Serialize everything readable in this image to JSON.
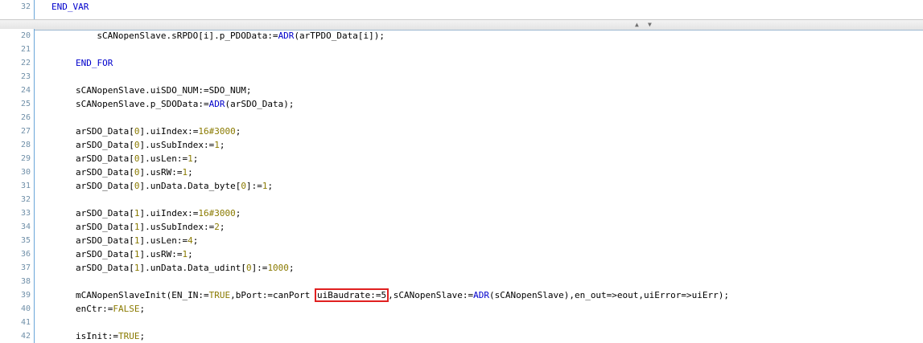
{
  "top_pane": {
    "line_number": "32",
    "text": "END_VAR"
  },
  "splitter": {
    "up_arrow": "▲",
    "down_arrow": "▼"
  },
  "lines": [
    {
      "n": "20",
      "indent": 8,
      "tokens": [
        [
          "sCANopenSlave.sRPDO[i].p_PDOData:=",
          ""
        ],
        [
          "ADR",
          "kw"
        ],
        [
          "(arTPDO_Data[i]);",
          ""
        ]
      ]
    },
    {
      "n": "21",
      "indent": 0,
      "tokens": []
    },
    {
      "n": "22",
      "indent": 4,
      "tokens": [
        [
          "END_FOR",
          "kw"
        ]
      ]
    },
    {
      "n": "23",
      "indent": 0,
      "tokens": []
    },
    {
      "n": "24",
      "indent": 4,
      "tokens": [
        [
          "sCANopenSlave.uiSDO_NUM:=SDO_NUM;",
          ""
        ]
      ]
    },
    {
      "n": "25",
      "indent": 4,
      "tokens": [
        [
          "sCANopenSlave.p_SDOData:=",
          ""
        ],
        [
          "ADR",
          "kw"
        ],
        [
          "(arSDO_Data);",
          ""
        ]
      ]
    },
    {
      "n": "26",
      "indent": 0,
      "tokens": []
    },
    {
      "n": "27",
      "indent": 4,
      "tokens": [
        [
          "arSDO_Data[",
          ""
        ],
        [
          "0",
          "num"
        ],
        [
          "].uiIndex:=",
          ""
        ],
        [
          "16#3000",
          "num"
        ],
        [
          ";",
          ""
        ]
      ]
    },
    {
      "n": "28",
      "indent": 4,
      "tokens": [
        [
          "arSDO_Data[",
          ""
        ],
        [
          "0",
          "num"
        ],
        [
          "].usSubIndex:=",
          ""
        ],
        [
          "1",
          "num"
        ],
        [
          ";",
          ""
        ]
      ]
    },
    {
      "n": "29",
      "indent": 4,
      "tokens": [
        [
          "arSDO_Data[",
          ""
        ],
        [
          "0",
          "num"
        ],
        [
          "].usLen:=",
          ""
        ],
        [
          "1",
          "num"
        ],
        [
          ";",
          ""
        ]
      ]
    },
    {
      "n": "30",
      "indent": 4,
      "tokens": [
        [
          "arSDO_Data[",
          ""
        ],
        [
          "0",
          "num"
        ],
        [
          "].usRW:=",
          ""
        ],
        [
          "1",
          "num"
        ],
        [
          ";",
          ""
        ]
      ]
    },
    {
      "n": "31",
      "indent": 4,
      "tokens": [
        [
          "arSDO_Data[",
          ""
        ],
        [
          "0",
          "num"
        ],
        [
          "].unData.Data_byte[",
          ""
        ],
        [
          "0",
          "num"
        ],
        [
          "]:=",
          ""
        ],
        [
          "1",
          "num"
        ],
        [
          ";",
          ""
        ]
      ]
    },
    {
      "n": "32",
      "indent": 0,
      "tokens": []
    },
    {
      "n": "33",
      "indent": 4,
      "tokens": [
        [
          "arSDO_Data[",
          ""
        ],
        [
          "1",
          "num"
        ],
        [
          "].uiIndex:=",
          ""
        ],
        [
          "16#3000",
          "num"
        ],
        [
          ";",
          ""
        ]
      ]
    },
    {
      "n": "34",
      "indent": 4,
      "tokens": [
        [
          "arSDO_Data[",
          ""
        ],
        [
          "1",
          "num"
        ],
        [
          "].usSubIndex:=",
          ""
        ],
        [
          "2",
          "num"
        ],
        [
          ";",
          ""
        ]
      ]
    },
    {
      "n": "35",
      "indent": 4,
      "tokens": [
        [
          "arSDO_Data[",
          ""
        ],
        [
          "1",
          "num"
        ],
        [
          "].usLen:=",
          ""
        ],
        [
          "4",
          "num"
        ],
        [
          ";",
          ""
        ]
      ]
    },
    {
      "n": "36",
      "indent": 4,
      "tokens": [
        [
          "arSDO_Data[",
          ""
        ],
        [
          "1",
          "num"
        ],
        [
          "].usRW:=",
          ""
        ],
        [
          "1",
          "num"
        ],
        [
          ";",
          ""
        ]
      ]
    },
    {
      "n": "37",
      "indent": 4,
      "tokens": [
        [
          "arSDO_Data[",
          ""
        ],
        [
          "1",
          "num"
        ],
        [
          "].unData.Data_udint[",
          ""
        ],
        [
          "0",
          "num"
        ],
        [
          "]:=",
          ""
        ],
        [
          "1000",
          "num"
        ],
        [
          ";",
          ""
        ]
      ]
    },
    {
      "n": "38",
      "indent": 0,
      "tokens": []
    },
    {
      "n": "39",
      "indent": 4,
      "tokens": [
        [
          "mCANopenSlaveInit(EN_IN:=",
          ""
        ],
        [
          "TRUE",
          "num"
        ],
        [
          ",bPort:=canPort ",
          ""
        ],
        [
          "uiBaudrate:=5",
          "box"
        ],
        [
          ",sCANopenSlave:=",
          ""
        ],
        [
          "ADR",
          "kw"
        ],
        [
          "(sCANopenSlave),en_out=>eout,uiError=>uiErr);",
          ""
        ]
      ]
    },
    {
      "n": "40",
      "indent": 4,
      "tokens": [
        [
          "enCtr:=",
          ""
        ],
        [
          "FALSE",
          "num"
        ],
        [
          ";",
          ""
        ]
      ]
    },
    {
      "n": "41",
      "indent": 0,
      "tokens": []
    },
    {
      "n": "42",
      "indent": 4,
      "tokens": [
        [
          "isInit:=",
          ""
        ],
        [
          "TRUE",
          "num"
        ],
        [
          ";",
          ""
        ]
      ]
    }
  ],
  "colors": {
    "keyword": "#0000cc",
    "literal": "#8a7a00",
    "highlight_border": "#e02020",
    "gutter_border": "#6aa6d8"
  }
}
